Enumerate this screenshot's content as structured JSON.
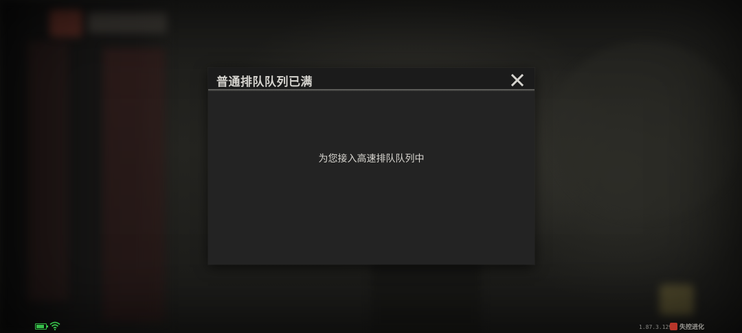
{
  "dialog": {
    "title": "普通排队队列已满",
    "message": "为您接入高速排队队列中",
    "close_icon": "close-icon"
  },
  "status_bar": {
    "battery_level": 0.75,
    "battery_color": "#37c24a",
    "wifi_icon": "wifi-icon",
    "version": "1.87.3.1291",
    "brand": "失控进化"
  }
}
